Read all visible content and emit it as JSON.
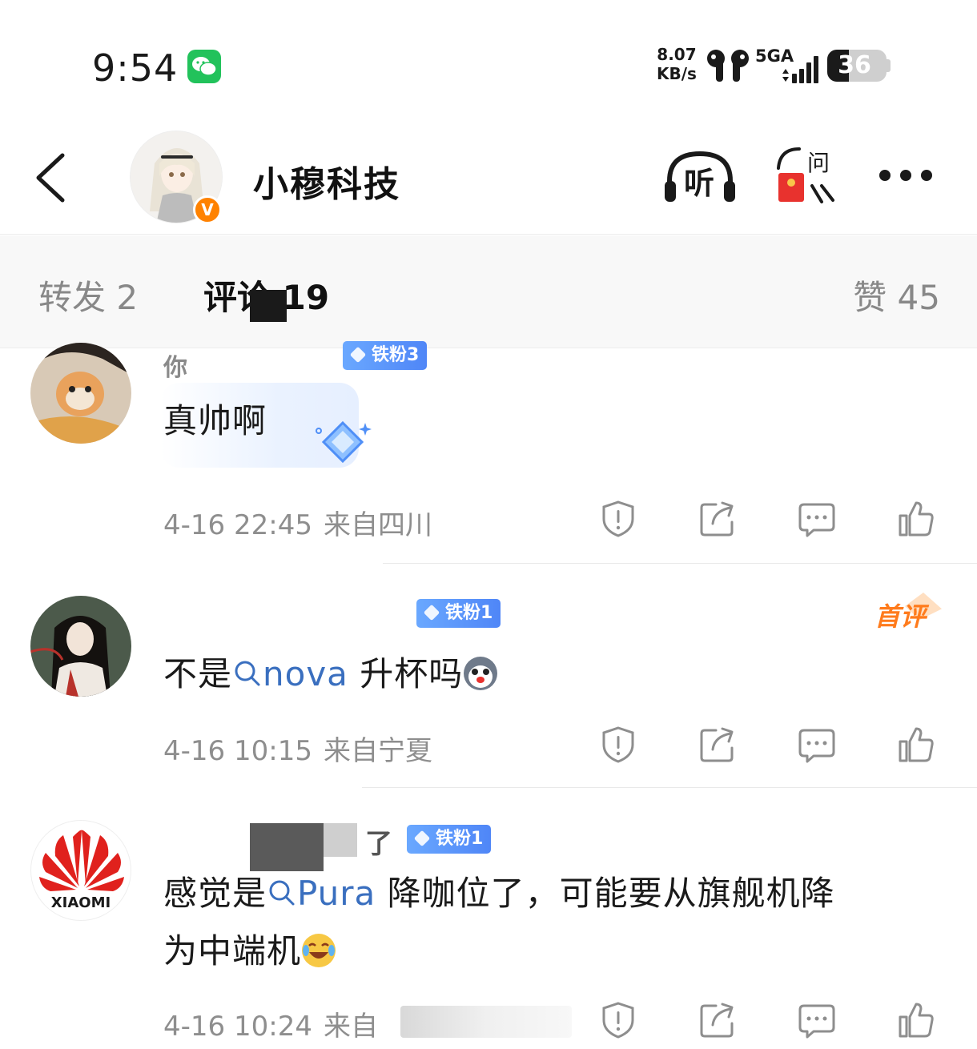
{
  "status_bar": {
    "time": "9:54",
    "net_speed_value": "8.07",
    "net_speed_unit": "KB/s",
    "network": "5GA",
    "battery": "36",
    "battery_level": 0.36
  },
  "header": {
    "account_name": "小穆科技",
    "listen_label": "听",
    "ask_label": "问",
    "verified_mark": "V"
  },
  "tabs": {
    "forward": "转发 2",
    "comments": "评论 19",
    "likes": "赞 45"
  },
  "comments": [
    {
      "username": "你",
      "badge": "铁粉3",
      "text": "真帅啊",
      "time": "4-16 22:45",
      "location": "来自四川"
    },
    {
      "username": "",
      "badge": "铁粉1",
      "first_badge": "首评",
      "text_before": "不是",
      "topic": "nova",
      "text_after": " 升杯吗",
      "time": "4-16 10:15",
      "location": "来自宁夏"
    },
    {
      "username": "了",
      "badge": "铁粉1",
      "avatar_text": "XIAOMI",
      "text_before": "感觉是",
      "topic": "Pura",
      "text_after": " 降咖位了，可能要从旗舰机降",
      "text_line2": "为中端机",
      "time": "4-16 10:24",
      "location": "来自"
    }
  ],
  "colors": {
    "accent_orange": "#ff8200",
    "topic_blue": "#3a6fbf",
    "badge_blue": "#5b8ff9",
    "wechat_green": "#22c25b"
  }
}
